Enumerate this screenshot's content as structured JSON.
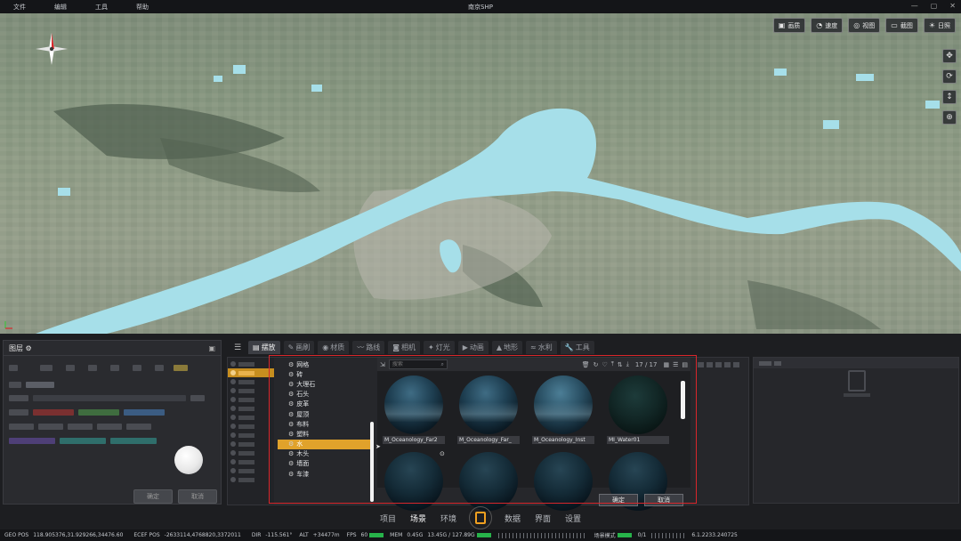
{
  "app": {
    "title": "南京SHP",
    "menus": [
      "文件",
      "编辑",
      "工具",
      "帮助"
    ],
    "window_controls": [
      "—",
      "▢",
      "✕"
    ]
  },
  "viewport": {
    "toolbar": [
      {
        "icon": "image-icon",
        "label": "画质"
      },
      {
        "icon": "speed-icon",
        "label": "速度"
      },
      {
        "icon": "view-icon",
        "label": "视图"
      },
      {
        "icon": "screenshot-icon",
        "label": "截图"
      },
      {
        "icon": "sun-icon",
        "label": "日照"
      }
    ],
    "nav_tools": [
      "✥",
      "⟳",
      "↕",
      "⊕"
    ],
    "compass_labels": {
      "north": "N"
    }
  },
  "layer_panel": {
    "title": "图层",
    "title_icon": "⚙",
    "header_icon": "▣",
    "buttons": [
      "确定",
      "取消"
    ]
  },
  "asset_panel": {
    "menu_icon": "☰",
    "tabs": [
      {
        "icon": "▤",
        "label": "摆放"
      },
      {
        "icon": "✎",
        "label": "画刷"
      },
      {
        "icon": "◉",
        "label": "材质"
      },
      {
        "icon": "〰",
        "label": "路线"
      },
      {
        "icon": "◙",
        "label": "相机"
      },
      {
        "icon": "✦",
        "label": "灯光"
      },
      {
        "icon": "▶",
        "label": "动画"
      },
      {
        "icon": "▲",
        "label": "地形"
      },
      {
        "icon": "≈",
        "label": "水利"
      },
      {
        "icon": "🔧",
        "label": "工具"
      }
    ],
    "categories": [
      "网格",
      "砖",
      "大理石",
      "石头",
      "皮革",
      "屋顶",
      "布料",
      "塑料",
      "水",
      "木头",
      "墙面",
      "车漆"
    ],
    "selected_category": "水",
    "search_placeholder": "搜索",
    "count": "17 / 17",
    "toolbar_icons": [
      "🗑",
      "↻",
      "♡",
      "⤒",
      "⇅",
      "⤓"
    ],
    "view_icons": [
      "▦",
      "☰",
      "▤"
    ],
    "assets": [
      {
        "label": "M_Oceanology_Far2",
        "style": "far"
      },
      {
        "label": "M_Oceanology_Far_",
        "style": "far"
      },
      {
        "label": "M_Oceanology_Inst",
        "style": "inst"
      },
      {
        "label": "MI_Water01",
        "style": "water"
      }
    ],
    "ok_label": "确定",
    "cancel_label": "取消"
  },
  "bottom_nav": {
    "left": [
      "项目",
      "场景",
      "环境"
    ],
    "right": [
      "数据",
      "界面",
      "设置"
    ],
    "active": "场景"
  },
  "status": {
    "geo_pos_label": "GEO POS",
    "geo_pos": "118.905376,31.929266,34476.60",
    "ecef_label": "ECEF POS",
    "ecef_pos": "-2633114,4768820,3372011",
    "dir_label": "DIR",
    "dir": "-115.561°",
    "alt_label": "ALT",
    "alt": "+34477m",
    "fps_label": "FPS",
    "fps": "60",
    "mem_label": "MEM",
    "mem": "0.45G",
    "mem2": "13.45G / 127.89G",
    "mode": "场景模式",
    "progress": "0/1",
    "version": "6.1.2233.240725"
  }
}
